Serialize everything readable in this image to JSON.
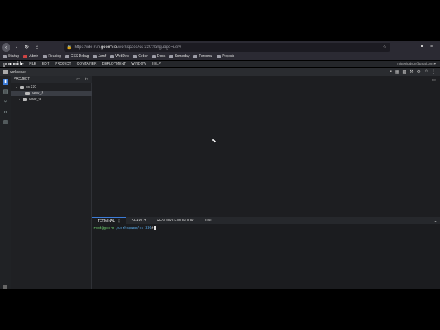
{
  "browser": {
    "url_prefix": "https://ide-run.",
    "url_host": "goorm.io",
    "url_path": "/workspace/cs-330?language=usr#",
    "url_menu": "···",
    "star": "☆",
    "ext_icon": "●",
    "more_icon": "≡"
  },
  "bookmarks": [
    {
      "label": "Startup"
    },
    {
      "label": "Admin"
    },
    {
      "label": "Reading"
    },
    {
      "label": "CSS Debug"
    },
    {
      "label": "Jamf"
    },
    {
      "label": "WebDev"
    },
    {
      "label": "Ceber"
    },
    {
      "label": "Docs"
    },
    {
      "label": "Someday"
    },
    {
      "label": "Personal"
    },
    {
      "label": "Projects"
    }
  ],
  "ide": {
    "logo": "goormide",
    "menu": [
      "FILE",
      "EDIT",
      "PROJECT",
      "CONTAINER",
      "DEPLOYMENT",
      "WINDOW",
      "HELP"
    ],
    "user": "misterhudson@gmail.com ▾",
    "workspace_tab": "workspace"
  },
  "project": {
    "header": "PROJECT",
    "tools": [
      "+",
      "▭",
      "↻"
    ],
    "tree": [
      {
        "label": "cs-330",
        "chev": "⌄"
      },
      {
        "label": "week_8",
        "chev": ""
      },
      {
        "label": "week_9",
        "chev": "›"
      }
    ]
  },
  "terminal": {
    "tabs": [
      "TERMINAL",
      "SEARCH",
      "RESOURCE MONITOR",
      "LINT"
    ],
    "prompt_user": "root@goorm",
    "prompt_path": ":/workspace/cs-330",
    "prompt_end": "#"
  },
  "colors": {
    "accent": "#3c7bd6",
    "background": "#1d1e21"
  }
}
